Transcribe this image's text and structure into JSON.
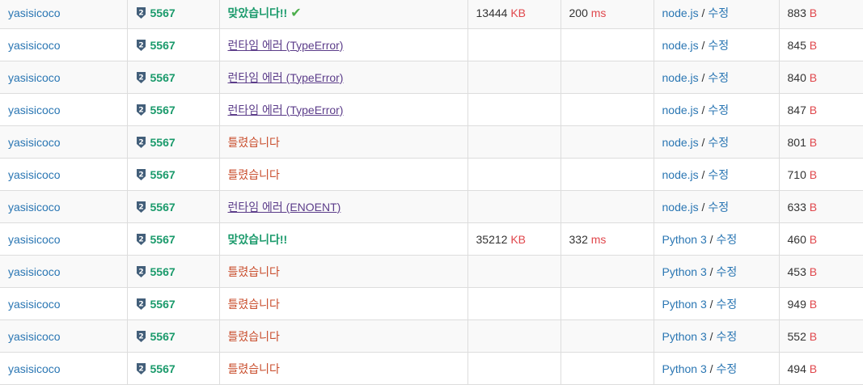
{
  "rows": [
    {
      "user": "yasisicoco",
      "problem": "5567",
      "result": "맞았습니다!!",
      "result_type": "ac",
      "show_check": true,
      "memory": "13444",
      "memory_unit": "KB",
      "time": "200",
      "time_unit": "ms",
      "language": "node.js",
      "edit": "수정",
      "length": "883",
      "length_unit": "B"
    },
    {
      "user": "yasisicoco",
      "problem": "5567",
      "result": "런타임 에러 (TypeError)",
      "result_type": "rte",
      "show_check": false,
      "memory": "",
      "memory_unit": "",
      "time": "",
      "time_unit": "",
      "language": "node.js",
      "edit": "수정",
      "length": "845",
      "length_unit": "B"
    },
    {
      "user": "yasisicoco",
      "problem": "5567",
      "result": "런타임 에러 (TypeError)",
      "result_type": "rte",
      "show_check": false,
      "memory": "",
      "memory_unit": "",
      "time": "",
      "time_unit": "",
      "language": "node.js",
      "edit": "수정",
      "length": "840",
      "length_unit": "B"
    },
    {
      "user": "yasisicoco",
      "problem": "5567",
      "result": "런타임 에러 (TypeError)",
      "result_type": "rte",
      "show_check": false,
      "memory": "",
      "memory_unit": "",
      "time": "",
      "time_unit": "",
      "language": "node.js",
      "edit": "수정",
      "length": "847",
      "length_unit": "B"
    },
    {
      "user": "yasisicoco",
      "problem": "5567",
      "result": "틀렸습니다",
      "result_type": "wa",
      "show_check": false,
      "memory": "",
      "memory_unit": "",
      "time": "",
      "time_unit": "",
      "language": "node.js",
      "edit": "수정",
      "length": "801",
      "length_unit": "B"
    },
    {
      "user": "yasisicoco",
      "problem": "5567",
      "result": "틀렸습니다",
      "result_type": "wa",
      "show_check": false,
      "memory": "",
      "memory_unit": "",
      "time": "",
      "time_unit": "",
      "language": "node.js",
      "edit": "수정",
      "length": "710",
      "length_unit": "B"
    },
    {
      "user": "yasisicoco",
      "problem": "5567",
      "result": "런타임 에러 (ENOENT)",
      "result_type": "rte",
      "show_check": false,
      "memory": "",
      "memory_unit": "",
      "time": "",
      "time_unit": "",
      "language": "node.js",
      "edit": "수정",
      "length": "633",
      "length_unit": "B"
    },
    {
      "user": "yasisicoco",
      "problem": "5567",
      "result": "맞았습니다!!",
      "result_type": "ac",
      "show_check": false,
      "memory": "35212",
      "memory_unit": "KB",
      "time": "332",
      "time_unit": "ms",
      "language": "Python 3",
      "edit": "수정",
      "length": "460",
      "length_unit": "B"
    },
    {
      "user": "yasisicoco",
      "problem": "5567",
      "result": "틀렸습니다",
      "result_type": "wa",
      "show_check": false,
      "memory": "",
      "memory_unit": "",
      "time": "",
      "time_unit": "",
      "language": "Python 3",
      "edit": "수정",
      "length": "453",
      "length_unit": "B"
    },
    {
      "user": "yasisicoco",
      "problem": "5567",
      "result": "틀렸습니다",
      "result_type": "wa",
      "show_check": false,
      "memory": "",
      "memory_unit": "",
      "time": "",
      "time_unit": "",
      "language": "Python 3",
      "edit": "수정",
      "length": "949",
      "length_unit": "B"
    },
    {
      "user": "yasisicoco",
      "problem": "5567",
      "result": "틀렸습니다",
      "result_type": "wa",
      "show_check": false,
      "memory": "",
      "memory_unit": "",
      "time": "",
      "time_unit": "",
      "language": "Python 3",
      "edit": "수정",
      "length": "552",
      "length_unit": "B"
    },
    {
      "user": "yasisicoco",
      "problem": "5567",
      "result": "틀렸습니다",
      "result_type": "wa",
      "show_check": false,
      "memory": "",
      "memory_unit": "",
      "time": "",
      "time_unit": "",
      "language": "Python 3",
      "edit": "수정",
      "length": "494",
      "length_unit": "B"
    }
  ],
  "icons": {
    "tier": "silver-tier-2-shield-icon",
    "check": "check-mark-icon"
  },
  "tier_label": "2",
  "separator": " / ",
  "check_glyph": "✔",
  "colors": {
    "ac": "#1a9a6b",
    "wa": "#c94d2c",
    "rte": "#5c3d8a",
    "link": "#2a76b3",
    "unit": "#e0474c",
    "tier": "#435f7a"
  }
}
